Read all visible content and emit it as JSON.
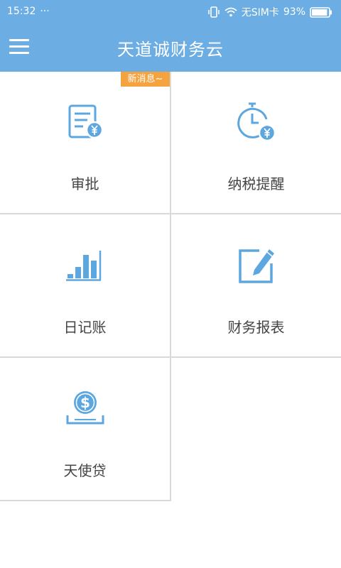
{
  "status_bar": {
    "time": "15:32",
    "dots": "···",
    "carrier": "无SIM卡",
    "battery_percent": "93%",
    "battery_level": 0.93
  },
  "header": {
    "title": "天道诚财务云",
    "menu_icon": "hamburger-menu-icon"
  },
  "tiles": [
    {
      "label": "审批",
      "icon": "document-yen-icon",
      "badge": "新消息~"
    },
    {
      "label": "纳税提醒",
      "icon": "clock-yen-icon"
    },
    {
      "label": "日记账",
      "icon": "bar-chart-icon"
    },
    {
      "label": "财务报表",
      "icon": "edit-pencil-icon"
    },
    {
      "label": "天使贷",
      "icon": "dollar-coin-icon"
    }
  ],
  "colors": {
    "header_bg": "#6caee3",
    "icon_blue": "#5da7e0",
    "badge_orange": "#f5a33f",
    "label_text": "#444444",
    "divider": "#d9d9d9"
  }
}
